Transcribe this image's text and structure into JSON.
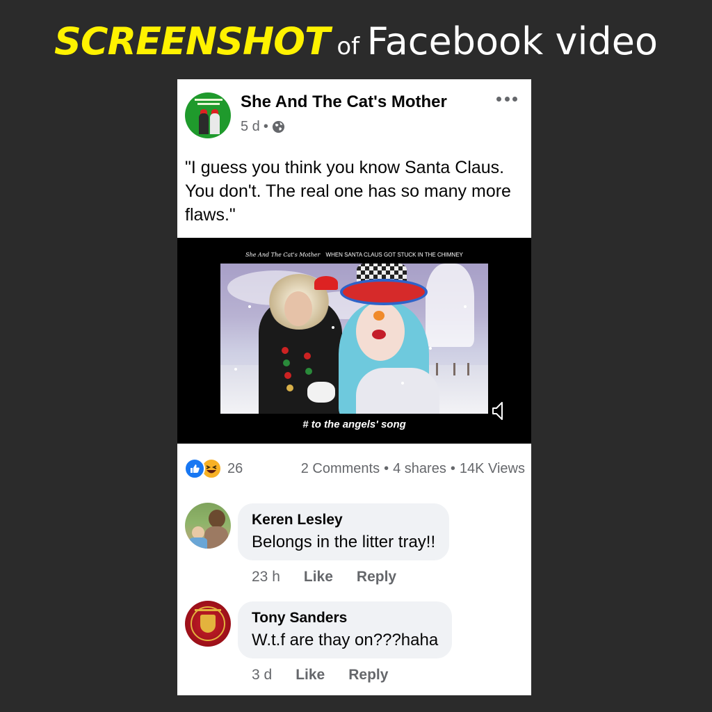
{
  "banner": {
    "word1": "SCREENSHOT",
    "word2": "of",
    "word3": "Facebook video"
  },
  "post": {
    "page_name": "She And The Cat's Mother",
    "time": "5 d",
    "dot": "•",
    "privacy_icon": "globe-icon",
    "more_icon": "more-dots-icon",
    "text": "\"I guess you think you know Santa Claus. You don't. The real one has so many more flaws.\""
  },
  "video": {
    "header_name": "She And The Cat's Mother",
    "header_title": "WHEN SANTA CLAUS GOT STUCK IN THE CHIMNEY",
    "caption": "# to the angels' song",
    "volume_icon": "volume-muted-icon"
  },
  "stats": {
    "reaction_count": "26",
    "comments": "2 Comments",
    "shares": "4 shares",
    "views": "14K Views",
    "sep": "•"
  },
  "comments": [
    {
      "author": "Keren Lesley",
      "text": "Belongs in the litter tray!!",
      "time": "23 h",
      "like": "Like",
      "reply": "Reply"
    },
    {
      "author": "Tony Sanders",
      "text": "W.t.f are thay on???haha",
      "time": "3 d",
      "like": "Like",
      "reply": "Reply"
    }
  ],
  "colors": {
    "banner_accent": "#fff200",
    "like_blue": "#1877f2",
    "haha_yellow": "#f7b125",
    "secondary_text": "#65676b",
    "bubble_bg": "#f0f2f5"
  }
}
